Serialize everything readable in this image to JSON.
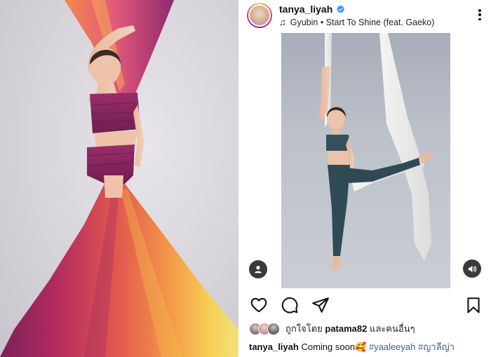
{
  "post": {
    "username": "tanya_liyah",
    "music": "Gyubin • Start To Shine (feat. Gaeko)",
    "liked_by_prefix": "ถูกใจโดย",
    "liked_by_user": "patama82",
    "liked_by_suffix": "และคนอื่นๆ",
    "caption_user": "tanya_liyah",
    "caption_text": "Coming soon",
    "caption_emoji": "🥰",
    "hashtags": [
      "#yaaleeyah",
      "#ญาลีญ่า"
    ]
  },
  "icons": {
    "verified": "verified-badge-icon",
    "music": "music-note-icon",
    "more": "more-options-icon",
    "user_tag": "user-tag-icon",
    "volume": "volume-icon",
    "like": "heart-icon",
    "comment": "comment-icon",
    "share": "share-icon",
    "save": "bookmark-icon"
  },
  "colors": {
    "verified_blue": "#3897f0",
    "hashtag_link": "#3a5f9e",
    "text": "#111111"
  }
}
